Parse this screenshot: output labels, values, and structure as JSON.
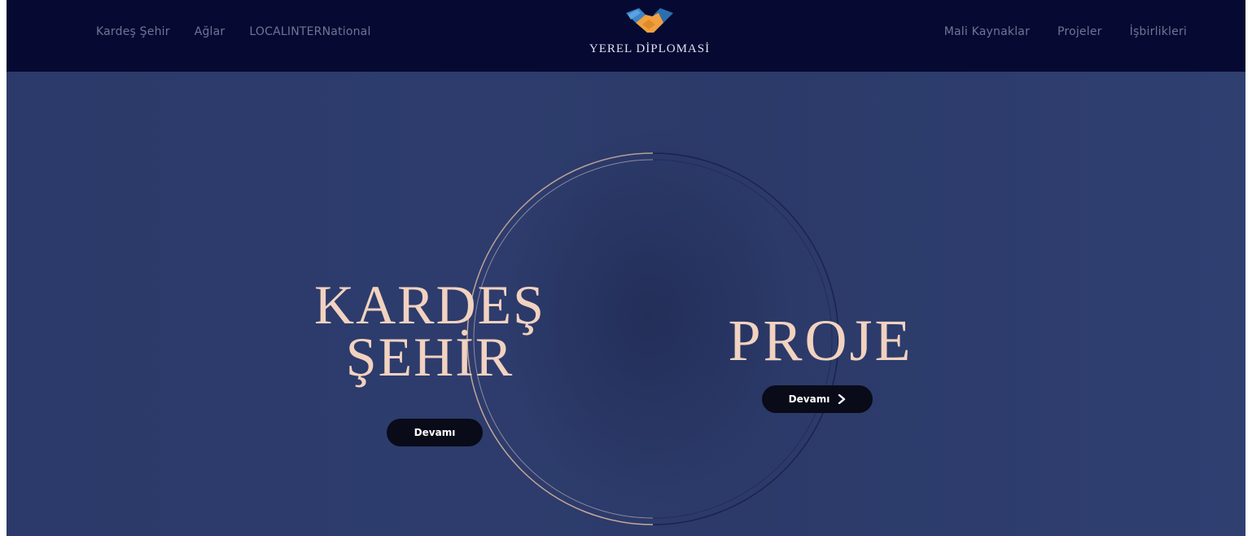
{
  "nav": {
    "left": [
      "Kardeş Şehir",
      "Ağlar",
      "LOCALINTERNational"
    ],
    "right": [
      "Mali Kaynaklar",
      "Projeler",
      "İşbirlikleri"
    ]
  },
  "logo": {
    "text": "YEREL DİPLOMASİ",
    "icon": "handshake-icon"
  },
  "hero": {
    "left_title_line1": "KARDEŞ",
    "left_title_line2": "ŞEHİR",
    "left_button": "Devamı",
    "right_title": "PROJE",
    "right_button": "Devamı",
    "right_button_icon": "chevron-right-icon"
  },
  "colors": {
    "topbar": "#060a32",
    "hero_bg": "#2d3c6c",
    "title": "#f2d2c0",
    "button_bg": "#0a0b18",
    "nav_text": "#6f7396"
  }
}
